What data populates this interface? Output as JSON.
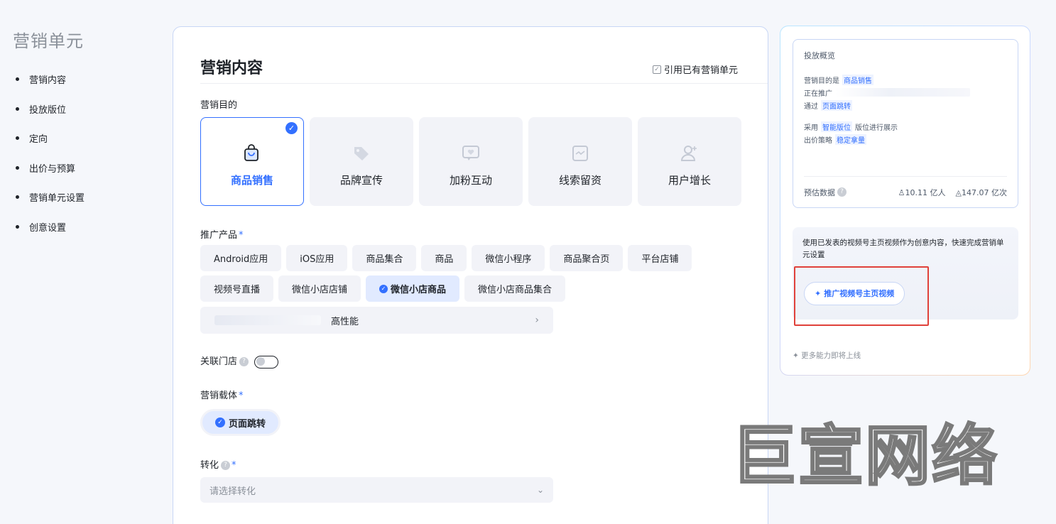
{
  "nav": {
    "title": "营销单元",
    "items": [
      "营销内容",
      "投放版位",
      "定向",
      "出价与预算",
      "营销单元设置",
      "创意设置"
    ]
  },
  "main": {
    "title": "营销内容",
    "cite_label": "引用已有营销单元",
    "goal_label": "营销目的",
    "goals": [
      {
        "label": "商品销售",
        "selected": true,
        "icon": "shopping-bag-icon"
      },
      {
        "label": "品牌宣传",
        "selected": false,
        "icon": "tag-icon"
      },
      {
        "label": "加粉互动",
        "selected": false,
        "icon": "heart-message-icon"
      },
      {
        "label": "线索留资",
        "selected": false,
        "icon": "form-icon"
      },
      {
        "label": "用户增长",
        "selected": false,
        "icon": "add-user-icon"
      }
    ],
    "product_label": "推广产品",
    "products_row1": [
      "Android应用",
      "iOS应用",
      "商品集合",
      "商品",
      "微信小程序",
      "商品聚合页",
      "平台店铺"
    ],
    "products_row2": [
      "视频号直播",
      "微信小店店铺",
      "微信小店商品",
      "微信小店商品集合"
    ],
    "selected_product": "微信小店商品",
    "product_selector_text": "高性能",
    "store_label": "关联门店",
    "carrier_label": "营销载体",
    "carrier_value": "页面跳转",
    "convert_label": "转化",
    "convert_placeholder": "请选择转化"
  },
  "overview": {
    "title": "投放概览",
    "goal_prefix": "营销目的是",
    "goal_value": "商品销售",
    "promoting_prefix": "正在推广",
    "via_prefix": "通过",
    "via_value": "页面跳转",
    "adopt_prefix": "采用",
    "adopt_value": "智能版位",
    "adopt_suffix": "版位进行展示",
    "bid_prefix": "出价策略",
    "bid_value": "稳定拿量",
    "estimate_label": "预估数据",
    "users": "10.11 亿人",
    "impressions": "147.07 亿次"
  },
  "promo": {
    "text": "使用已发表的视频号主页视频作为创意内容，快速完成营销单元设置",
    "button": "推广视频号主页视频",
    "more": "更多能力即将上线"
  },
  "watermark": "巨宣网络",
  "colors": {
    "accent": "#3370ff",
    "highlight_box": "#e0413a"
  }
}
